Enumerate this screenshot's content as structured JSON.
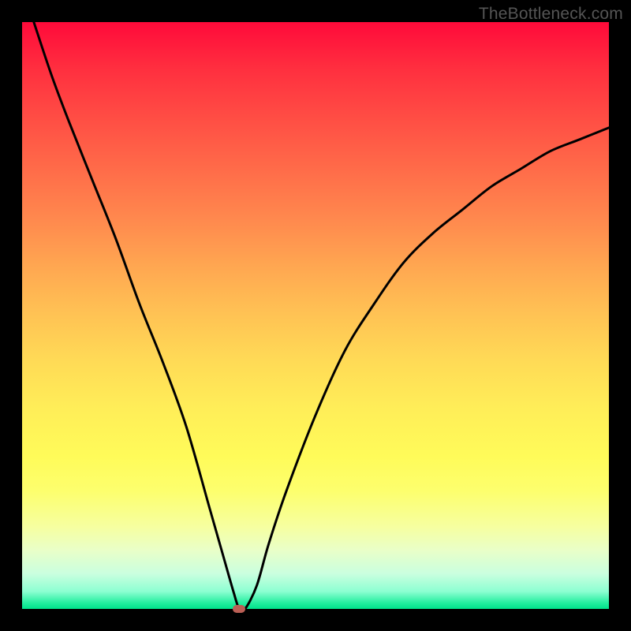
{
  "watermark": "TheBottleneck.com",
  "chart_data": {
    "type": "line",
    "title": "",
    "xlabel": "",
    "ylabel": "",
    "xlim": [
      0,
      100
    ],
    "ylim": [
      0,
      100
    ],
    "series": [
      {
        "name": "bottleneck-curve",
        "x": [
          2,
          5,
          8,
          12,
          16,
          20,
          24,
          28,
          32,
          34,
          36,
          37,
          38,
          40,
          42,
          45,
          50,
          55,
          60,
          65,
          70,
          75,
          80,
          85,
          90,
          95,
          100
        ],
        "y": [
          100,
          91,
          83,
          73,
          63,
          52,
          42,
          31,
          17,
          10,
          3,
          0,
          0,
          4,
          11,
          20,
          33,
          44,
          52,
          59,
          64,
          68,
          72,
          75,
          78,
          80,
          82
        ]
      }
    ],
    "marker": {
      "x": 37,
      "y": 0,
      "color": "#bb5f55"
    },
    "background_gradient": {
      "top": "#ff0a3a",
      "bottom": "#00e28a",
      "description": "vertical heat gradient red-orange-yellow-green"
    }
  }
}
